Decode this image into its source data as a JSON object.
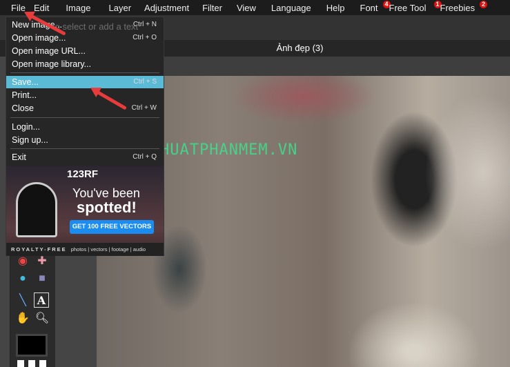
{
  "menubar": [
    {
      "label": "File"
    },
    {
      "label": "Edit"
    },
    {
      "label": "Image"
    },
    {
      "label": "Layer"
    },
    {
      "label": "Adjustment"
    },
    {
      "label": "Filter"
    },
    {
      "label": "View"
    },
    {
      "label": "Language"
    },
    {
      "label": "Help"
    },
    {
      "label": "Font",
      "badge": "4"
    },
    {
      "label": "Free Tool",
      "badge": "1"
    },
    {
      "label": "Freebies",
      "badge": "2"
    }
  ],
  "tool_hint": "to select or add a text",
  "document_title": "Ảnh đẹp (3)",
  "watermark": "THUTHUATPHANMEM.VN",
  "file_menu": {
    "new_image": "New image...",
    "new_image_sc": "Ctrl + N",
    "open_image": "Open image...",
    "open_image_sc": "Ctrl + O",
    "open_url": "Open image URL...",
    "open_library": "Open image library...",
    "save": "Save...",
    "save_sc": "Ctrl + S",
    "print": "Print...",
    "close": "Close",
    "close_sc": "Ctrl + W",
    "login": "Login...",
    "signup": "Sign up...",
    "exit": "Exit",
    "exit_sc": "Ctrl + Q"
  },
  "ad": {
    "brand": "123RF",
    "line1": "You've been",
    "line2": "spotted!",
    "cta": "GET 100 FREE VECTORS",
    "foot_left": "ROYALTY-FREE",
    "foot_right": "photos | vectors | footage | audio"
  }
}
